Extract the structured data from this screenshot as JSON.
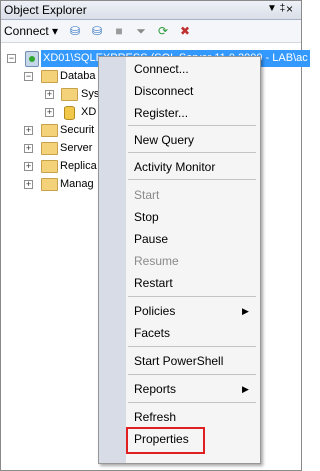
{
  "window": {
    "title": "Object Explorer",
    "pin_glyph": "▼ ‡",
    "close_glyph": "×"
  },
  "toolbar": {
    "connect_label": "Connect",
    "connect_arrow": "▾",
    "icons": [
      "connect-icon",
      "disconnect-icon",
      "stop-icon",
      "filter-icon",
      "refresh-icon",
      "close-icon"
    ]
  },
  "tree": {
    "server_label": "XD01\\SQLEXPRESS (SQL Server 11.0.3000 - LAB\\ac",
    "databases_label": "Databa",
    "system_db_label": "Sys",
    "xd_label": "XD",
    "security_label": "Securit",
    "server_objects_label": "Server",
    "replication_label": "Replica",
    "management_label": "Manag"
  },
  "context_menu": {
    "connect": "Connect...",
    "disconnect": "Disconnect",
    "register": "Register...",
    "new_query": "New Query",
    "activity_monitor": "Activity Monitor",
    "start": "Start",
    "stop": "Stop",
    "pause": "Pause",
    "resume": "Resume",
    "restart": "Restart",
    "policies": "Policies",
    "facets": "Facets",
    "start_powershell": "Start PowerShell",
    "reports": "Reports",
    "refresh": "Refresh",
    "properties": "Properties",
    "submenu_arrow": "▶"
  },
  "colors": {
    "selection": "#3399ff",
    "highlight_border": "#e02020"
  }
}
